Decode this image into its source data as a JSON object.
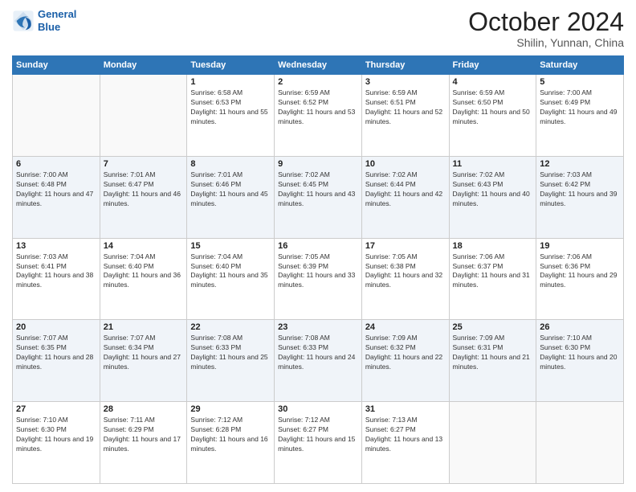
{
  "header": {
    "logo": {
      "line1": "General",
      "line2": "Blue"
    },
    "title": "October 2024",
    "subtitle": "Shilin, Yunnan, China"
  },
  "weekdays": [
    "Sunday",
    "Monday",
    "Tuesday",
    "Wednesday",
    "Thursday",
    "Friday",
    "Saturday"
  ],
  "weeks": [
    [
      {
        "day": "",
        "sunrise": "",
        "sunset": "",
        "daylight": ""
      },
      {
        "day": "",
        "sunrise": "",
        "sunset": "",
        "daylight": ""
      },
      {
        "day": "1",
        "sunrise": "Sunrise: 6:58 AM",
        "sunset": "Sunset: 6:53 PM",
        "daylight": "Daylight: 11 hours and 55 minutes."
      },
      {
        "day": "2",
        "sunrise": "Sunrise: 6:59 AM",
        "sunset": "Sunset: 6:52 PM",
        "daylight": "Daylight: 11 hours and 53 minutes."
      },
      {
        "day": "3",
        "sunrise": "Sunrise: 6:59 AM",
        "sunset": "Sunset: 6:51 PM",
        "daylight": "Daylight: 11 hours and 52 minutes."
      },
      {
        "day": "4",
        "sunrise": "Sunrise: 6:59 AM",
        "sunset": "Sunset: 6:50 PM",
        "daylight": "Daylight: 11 hours and 50 minutes."
      },
      {
        "day": "5",
        "sunrise": "Sunrise: 7:00 AM",
        "sunset": "Sunset: 6:49 PM",
        "daylight": "Daylight: 11 hours and 49 minutes."
      }
    ],
    [
      {
        "day": "6",
        "sunrise": "Sunrise: 7:00 AM",
        "sunset": "Sunset: 6:48 PM",
        "daylight": "Daylight: 11 hours and 47 minutes."
      },
      {
        "day": "7",
        "sunrise": "Sunrise: 7:01 AM",
        "sunset": "Sunset: 6:47 PM",
        "daylight": "Daylight: 11 hours and 46 minutes."
      },
      {
        "day": "8",
        "sunrise": "Sunrise: 7:01 AM",
        "sunset": "Sunset: 6:46 PM",
        "daylight": "Daylight: 11 hours and 45 minutes."
      },
      {
        "day": "9",
        "sunrise": "Sunrise: 7:02 AM",
        "sunset": "Sunset: 6:45 PM",
        "daylight": "Daylight: 11 hours and 43 minutes."
      },
      {
        "day": "10",
        "sunrise": "Sunrise: 7:02 AM",
        "sunset": "Sunset: 6:44 PM",
        "daylight": "Daylight: 11 hours and 42 minutes."
      },
      {
        "day": "11",
        "sunrise": "Sunrise: 7:02 AM",
        "sunset": "Sunset: 6:43 PM",
        "daylight": "Daylight: 11 hours and 40 minutes."
      },
      {
        "day": "12",
        "sunrise": "Sunrise: 7:03 AM",
        "sunset": "Sunset: 6:42 PM",
        "daylight": "Daylight: 11 hours and 39 minutes."
      }
    ],
    [
      {
        "day": "13",
        "sunrise": "Sunrise: 7:03 AM",
        "sunset": "Sunset: 6:41 PM",
        "daylight": "Daylight: 11 hours and 38 minutes."
      },
      {
        "day": "14",
        "sunrise": "Sunrise: 7:04 AM",
        "sunset": "Sunset: 6:40 PM",
        "daylight": "Daylight: 11 hours and 36 minutes."
      },
      {
        "day": "15",
        "sunrise": "Sunrise: 7:04 AM",
        "sunset": "Sunset: 6:40 PM",
        "daylight": "Daylight: 11 hours and 35 minutes."
      },
      {
        "day": "16",
        "sunrise": "Sunrise: 7:05 AM",
        "sunset": "Sunset: 6:39 PM",
        "daylight": "Daylight: 11 hours and 33 minutes."
      },
      {
        "day": "17",
        "sunrise": "Sunrise: 7:05 AM",
        "sunset": "Sunset: 6:38 PM",
        "daylight": "Daylight: 11 hours and 32 minutes."
      },
      {
        "day": "18",
        "sunrise": "Sunrise: 7:06 AM",
        "sunset": "Sunset: 6:37 PM",
        "daylight": "Daylight: 11 hours and 31 minutes."
      },
      {
        "day": "19",
        "sunrise": "Sunrise: 7:06 AM",
        "sunset": "Sunset: 6:36 PM",
        "daylight": "Daylight: 11 hours and 29 minutes."
      }
    ],
    [
      {
        "day": "20",
        "sunrise": "Sunrise: 7:07 AM",
        "sunset": "Sunset: 6:35 PM",
        "daylight": "Daylight: 11 hours and 28 minutes."
      },
      {
        "day": "21",
        "sunrise": "Sunrise: 7:07 AM",
        "sunset": "Sunset: 6:34 PM",
        "daylight": "Daylight: 11 hours and 27 minutes."
      },
      {
        "day": "22",
        "sunrise": "Sunrise: 7:08 AM",
        "sunset": "Sunset: 6:33 PM",
        "daylight": "Daylight: 11 hours and 25 minutes."
      },
      {
        "day": "23",
        "sunrise": "Sunrise: 7:08 AM",
        "sunset": "Sunset: 6:33 PM",
        "daylight": "Daylight: 11 hours and 24 minutes."
      },
      {
        "day": "24",
        "sunrise": "Sunrise: 7:09 AM",
        "sunset": "Sunset: 6:32 PM",
        "daylight": "Daylight: 11 hours and 22 minutes."
      },
      {
        "day": "25",
        "sunrise": "Sunrise: 7:09 AM",
        "sunset": "Sunset: 6:31 PM",
        "daylight": "Daylight: 11 hours and 21 minutes."
      },
      {
        "day": "26",
        "sunrise": "Sunrise: 7:10 AM",
        "sunset": "Sunset: 6:30 PM",
        "daylight": "Daylight: 11 hours and 20 minutes."
      }
    ],
    [
      {
        "day": "27",
        "sunrise": "Sunrise: 7:10 AM",
        "sunset": "Sunset: 6:30 PM",
        "daylight": "Daylight: 11 hours and 19 minutes."
      },
      {
        "day": "28",
        "sunrise": "Sunrise: 7:11 AM",
        "sunset": "Sunset: 6:29 PM",
        "daylight": "Daylight: 11 hours and 17 minutes."
      },
      {
        "day": "29",
        "sunrise": "Sunrise: 7:12 AM",
        "sunset": "Sunset: 6:28 PM",
        "daylight": "Daylight: 11 hours and 16 minutes."
      },
      {
        "day": "30",
        "sunrise": "Sunrise: 7:12 AM",
        "sunset": "Sunset: 6:27 PM",
        "daylight": "Daylight: 11 hours and 15 minutes."
      },
      {
        "day": "31",
        "sunrise": "Sunrise: 7:13 AM",
        "sunset": "Sunset: 6:27 PM",
        "daylight": "Daylight: 11 hours and 13 minutes."
      },
      {
        "day": "",
        "sunrise": "",
        "sunset": "",
        "daylight": ""
      },
      {
        "day": "",
        "sunrise": "",
        "sunset": "",
        "daylight": ""
      }
    ]
  ]
}
